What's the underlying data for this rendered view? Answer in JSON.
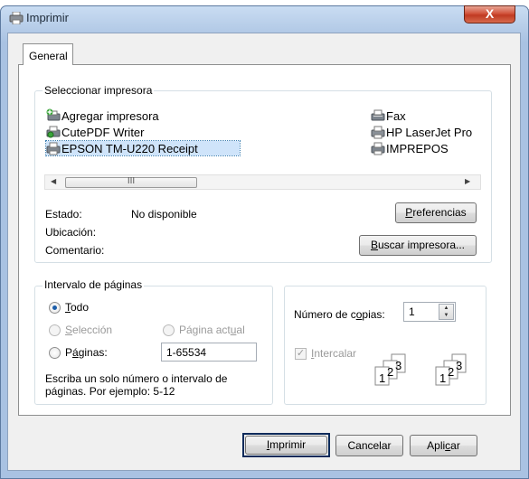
{
  "window": {
    "title": "Imprimir",
    "close_glyph": "X"
  },
  "tabs": [
    {
      "label": "General",
      "selected": true
    }
  ],
  "printer_group": {
    "legend": "Seleccionar impresora",
    "printers": [
      {
        "name": "Agregar impresora",
        "icon": "add-printer-icon",
        "selected": false
      },
      {
        "name": "CutePDF Writer",
        "icon": "printer-icon",
        "selected": false
      },
      {
        "name": "EPSON TM-U220 Receipt",
        "icon": "printer-icon",
        "selected": true
      },
      {
        "name": "Fax",
        "icon": "fax-icon",
        "selected": false
      },
      {
        "name": "HP LaserJet Pro",
        "icon": "printer-icon",
        "selected": false
      },
      {
        "name": "IMPREPOS",
        "icon": "printer-icon",
        "selected": false
      }
    ],
    "scroll_left": "◀",
    "scroll_right": "▶",
    "scroll_grip": "III",
    "status_label": "Estado:",
    "status_value": "No disponible",
    "location_label": "Ubicación:",
    "location_value": "",
    "comment_label": "Comentario:",
    "comment_value": "",
    "preferences_button": {
      "pre": "",
      "key": "P",
      "post": "referencias"
    },
    "find_printer_button": {
      "pre": "",
      "key": "B",
      "post": "uscar impresora..."
    }
  },
  "range_group": {
    "legend": "Intervalo de páginas",
    "all": {
      "pre": "",
      "key": "T",
      "post": "odo",
      "checked": true,
      "enabled": true
    },
    "selection": {
      "pre": "",
      "key": "S",
      "post": "elección",
      "checked": false,
      "enabled": false
    },
    "current_page": {
      "pre": "Página act",
      "key": "u",
      "post": "al",
      "checked": false,
      "enabled": false
    },
    "pages": {
      "pre": "P",
      "key": "á",
      "post": "ginas:",
      "checked": false,
      "enabled": true
    },
    "pages_value": "1-65534",
    "hint_line1": "Escriba un solo número o intervalo de",
    "hint_line2": "páginas. Por ejemplo: 5-12"
  },
  "copies_group": {
    "copies_label": {
      "pre": "Número de c",
      "key": "o",
      "post": "pias:"
    },
    "copies_value": "1",
    "spin_up": "▲",
    "spin_down": "▼",
    "collate": {
      "pre": "",
      "key": "I",
      "post": "ntercalar",
      "checked": true,
      "enabled": false
    },
    "collate_pages": [
      "1",
      "2",
      "3"
    ]
  },
  "buttons": {
    "print": {
      "pre": "",
      "key": "I",
      "post": "mprimir"
    },
    "cancel": {
      "label": "Cancelar"
    },
    "apply": {
      "pre": "Apli",
      "key": "c",
      "post": "ar"
    }
  },
  "colors": {
    "accent": "#1c5da9",
    "selection": "#cfe4fa",
    "default_button_border": "#0b2a5a"
  }
}
